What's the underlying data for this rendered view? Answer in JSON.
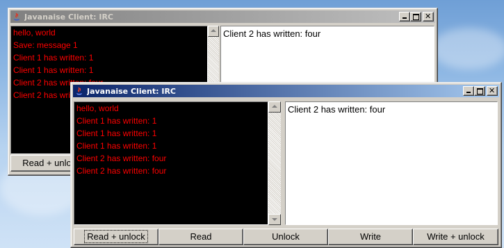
{
  "window_back": {
    "title": "Javanaise Client: IRC",
    "log_lines": [
      "hello, world",
      "Save: message 1",
      "Client 1 has written: 1",
      "Client 1 has written: 1",
      "Client 2 has written: four",
      "Client 2 has written: four"
    ],
    "text_value": "Client 2 has written: four",
    "buttons": [
      "Read + unlock"
    ]
  },
  "window_front": {
    "title": "Javanaise Client: IRC",
    "log_lines": [
      "hello, world",
      "Client 1 has written: 1",
      "Client 1 has written: 1",
      "Client 1 has written: 1",
      "Client 2 has written: four",
      "Client 2 has written: four"
    ],
    "text_value": "Client 2 has written: four",
    "buttons": [
      "Read + unlock",
      "Read",
      "Unlock",
      "Write",
      "Write + unlock"
    ]
  },
  "colors": {
    "log_text": "#ff0000",
    "active_title": "#0a246a",
    "inactive_title": "#808080"
  }
}
